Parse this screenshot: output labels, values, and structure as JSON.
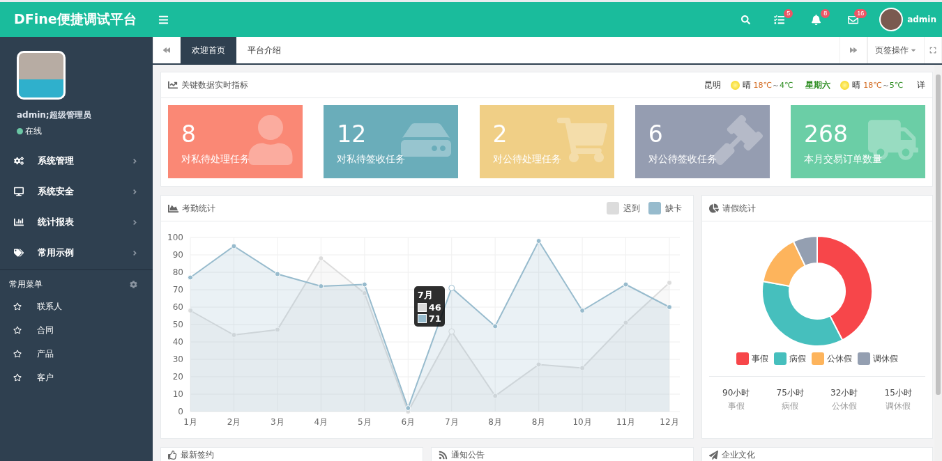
{
  "header": {
    "logo": "DFine便捷调试平台",
    "badges": [
      {
        "count": "5"
      },
      {
        "count": "8"
      },
      {
        "count": "16"
      }
    ],
    "user": "admin"
  },
  "sidebar": {
    "user_name": "admin;超级管理员",
    "status": "在线",
    "online": true,
    "menu": [
      {
        "label": "系统管理"
      },
      {
        "label": "系统安全"
      },
      {
        "label": "统计报表"
      },
      {
        "label": "常用示例"
      }
    ],
    "favorites_title": "常用菜单",
    "favorites": [
      {
        "label": "联系人"
      },
      {
        "label": "合同"
      },
      {
        "label": "产品"
      },
      {
        "label": "客户"
      }
    ]
  },
  "tabs": [
    {
      "label": "欢迎首页",
      "selected": true
    },
    {
      "label": "平台介绍",
      "selected": false
    }
  ],
  "tab_actions": "页签操作",
  "metrics": {
    "title": "关键数据实时指标",
    "weather": {
      "city": "昆明",
      "today": {
        "sky": "晴",
        "high": "18℃",
        "sep": "～",
        "low": "4℃"
      },
      "day": "星期六",
      "tomorrow": {
        "sky": "晴",
        "high": "18℃",
        "sep": "～",
        "low": "5℃"
      },
      "more": "详"
    },
    "cards": [
      {
        "value": "8",
        "label": "对私待处理任务",
        "color": "#fa8875"
      },
      {
        "value": "12",
        "label": "对私待签收任务",
        "color": "#6aadba"
      },
      {
        "value": "2",
        "label": "对公待处理任务",
        "color": "#f0cf86"
      },
      {
        "value": "6",
        "label": "对公待签收任务",
        "color": "#959db1"
      },
      {
        "value": "268",
        "label": "本月交易订单数量",
        "color": "#6bcea6"
      }
    ]
  },
  "attendance": {
    "title": "考勤统计",
    "chart_data": {
      "type": "area",
      "categories": [
        "1月",
        "2月",
        "3月",
        "4月",
        "5月",
        "6月",
        "7月",
        "8月",
        "8月",
        "10月",
        "11月",
        "12月"
      ],
      "series": [
        {
          "name": "迟到",
          "color": "#dcdcdc",
          "values": [
            58,
            44,
            47,
            88,
            68,
            0,
            46,
            9,
            27,
            25,
            51,
            74
          ]
        },
        {
          "name": "缺卡",
          "color": "#97bbcd",
          "values": [
            77,
            95,
            79,
            72,
            73,
            2,
            71,
            49,
            98,
            58,
            73,
            60
          ]
        }
      ],
      "ylim": [
        0,
        100
      ],
      "grid": true,
      "yticks": [
        0,
        10,
        20,
        30,
        40,
        50,
        60,
        70,
        80,
        90,
        100
      ]
    },
    "tooltip": {
      "title": "7月",
      "values": [
        "46",
        "71"
      ]
    }
  },
  "leave": {
    "title": "请假统计",
    "chart_data": {
      "type": "donut",
      "categories": [
        "事假",
        "病假",
        "公休假",
        "调休假"
      ],
      "values": [
        42.45,
        35.38,
        15.09,
        7.08
      ],
      "colors": [
        "#f7464a",
        "#46bfbd",
        "#fdb45c",
        "#949fb1"
      ]
    },
    "summary": [
      {
        "hours": "90小时",
        "label": "事假"
      },
      {
        "hours": "75小时",
        "label": "病假"
      },
      {
        "hours": "32小时",
        "label": "公休假"
      },
      {
        "hours": "15小时",
        "label": "调休假"
      }
    ]
  },
  "bottom_panels": [
    {
      "title": "最新签约"
    },
    {
      "title": "通知公告"
    },
    {
      "title": "企业文化"
    }
  ]
}
